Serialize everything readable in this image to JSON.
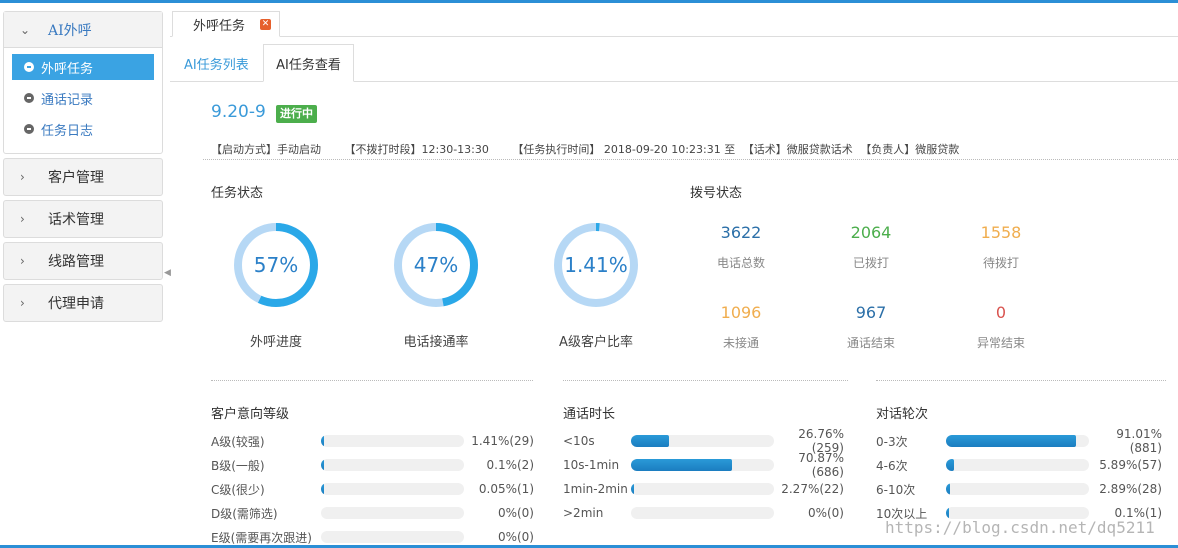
{
  "sidebar": {
    "open_group": "AI外呼",
    "sub_items": [
      {
        "label": "外呼任务",
        "active": true
      },
      {
        "label": "通话记录",
        "active": false
      },
      {
        "label": "任务日志",
        "active": false
      }
    ],
    "groups": [
      "客户管理",
      "话术管理",
      "线路管理",
      "代理申请"
    ]
  },
  "tabs": {
    "doc_tab": "外呼任务",
    "close_icon": "close-icon"
  },
  "subtabs": {
    "list": "AI任务列表",
    "view": "AI任务查看"
  },
  "task": {
    "title": "9.20-9",
    "status_badge": "进行中",
    "meta": {
      "start_mode": "【启动方式】手动启动",
      "no_dial": "【不拨打时段】12:30-13:30",
      "exec_time": "【任务执行时间】 2018-09-20 10:23:31 至",
      "script": "【话术】微服贷款话术",
      "owner": "【负责人】微服贷款"
    }
  },
  "task_status": {
    "title": "任务状态",
    "donuts": [
      {
        "value": "57%",
        "ratio": 0.57,
        "label": "外呼进度"
      },
      {
        "value": "47%",
        "ratio": 0.47,
        "label": "电话接通率"
      },
      {
        "value": "1.41%",
        "ratio": 0.0141,
        "label": "A级客户比率"
      }
    ]
  },
  "dial_status": {
    "title": "拨号状态",
    "stats": [
      {
        "value": "3622",
        "label": "电话总数",
        "color": "#2b6fa8"
      },
      {
        "value": "2064",
        "label": "已拨打",
        "color": "#4cae4c"
      },
      {
        "value": "1558",
        "label": "待拨打",
        "color": "#f0ad4e"
      },
      {
        "value": "1096",
        "label": "未接通",
        "color": "#f0ad4e"
      },
      {
        "value": "967",
        "label": "通话结束",
        "color": "#2b6fa8"
      },
      {
        "value": "0",
        "label": "异常结束",
        "color": "#d9534f"
      }
    ]
  },
  "intent": {
    "title": "客户意向等级",
    "rows": [
      {
        "label": "A级(较强)",
        "pct": "1.41%(29)",
        "ratio": 0.0141
      },
      {
        "label": "B级(一般)",
        "pct": "0.1%(2)",
        "ratio": 0.001
      },
      {
        "label": "C级(很少)",
        "pct": "0.05%(1)",
        "ratio": 0.0005
      },
      {
        "label": "D级(需筛选)",
        "pct": "0%(0)",
        "ratio": 0
      },
      {
        "label": "E级(需要再次跟进)",
        "pct": "0%(0)",
        "ratio": 0
      }
    ]
  },
  "duration": {
    "title": "通话时长",
    "rows": [
      {
        "label": "<10s",
        "pct": "26.76%(259)",
        "ratio": 0.2676
      },
      {
        "label": "10s-1min",
        "pct": "70.87%(686)",
        "ratio": 0.7087
      },
      {
        "label": "1min-2min",
        "pct": "2.27%(22)",
        "ratio": 0.0227
      },
      {
        "label": ">2min",
        "pct": "0%(0)",
        "ratio": 0
      }
    ]
  },
  "rounds": {
    "title": "对话轮次",
    "rows": [
      {
        "label": "0-3次",
        "pct": "91.01%(881)",
        "ratio": 0.9101
      },
      {
        "label": "4-6次",
        "pct": "5.89%(57)",
        "ratio": 0.0589
      },
      {
        "label": "6-10次",
        "pct": "2.89%(28)",
        "ratio": 0.0289
      },
      {
        "label": "10次以上",
        "pct": "0.1%(1)",
        "ratio": 0.001
      }
    ]
  },
  "watermark": "https://blog.csdn.net/dq5211"
}
